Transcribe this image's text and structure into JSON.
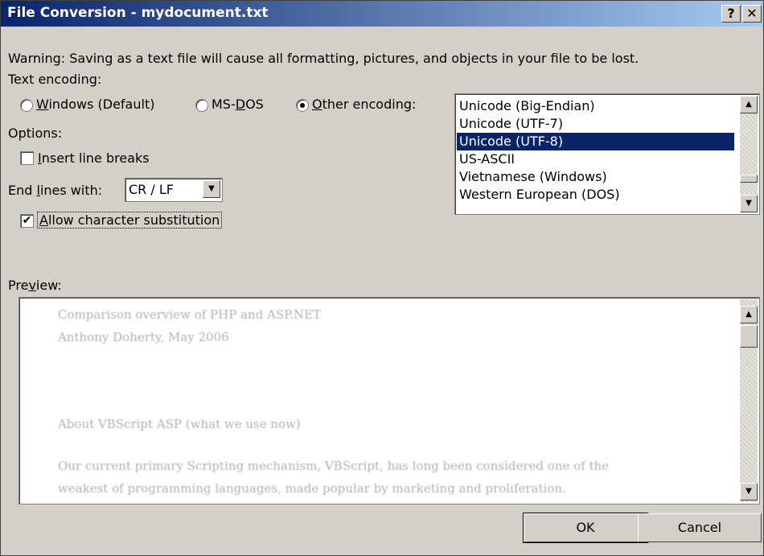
{
  "window": {
    "title": "File Conversion - mydocument.txt",
    "help_label": "?",
    "close_label": "✕"
  },
  "warning": "Warning: Saving as a text file will cause all formatting, pictures, and objects in your file to be lost.",
  "encoding": {
    "label": "Text encoding:",
    "options": [
      {
        "pre": "",
        "key": "W",
        "rest": "indows (Default)",
        "selected": false
      },
      {
        "pre": "MS-",
        "key": "D",
        "rest": "OS",
        "selected": false
      },
      {
        "pre": "",
        "key": "O",
        "rest": "ther encoding:",
        "selected": true
      }
    ],
    "list_items": [
      "Unicode (Big-Endian)",
      "Unicode (UTF-7)",
      "Unicode (UTF-8)",
      "US-ASCII",
      "Vietnamese (Windows)",
      "Western European (DOS)"
    ],
    "selected_item": "Unicode (UTF-8)"
  },
  "options": {
    "label": "Options:",
    "insert_line_breaks": {
      "key": "I",
      "rest": "nsert line breaks",
      "checked": false
    },
    "end_lines": {
      "pre": "End ",
      "key": "l",
      "rest": "ines with:",
      "value": "CR / LF"
    },
    "allow_substitution": {
      "key": "A",
      "rest": "llow character substitution",
      "checked": true
    }
  },
  "preview": {
    "pre": "Pre",
    "key": "v",
    "rest": "iew:",
    "lines": [
      "Comparison overview of PHP  and ASP.NET",
      "Anthony Doherty, May 2006",
      "About VBScript ASP (what we use now)",
      "Our current primary Scripting mechanism, VBScript, has long been considered one of the",
      "weakest of programming languages, made popular by marketing and proliferation."
    ]
  },
  "buttons": {
    "ok": "OK",
    "cancel": "Cancel"
  },
  "icons": {
    "up": "▲",
    "down": "▼",
    "check": "✔"
  }
}
